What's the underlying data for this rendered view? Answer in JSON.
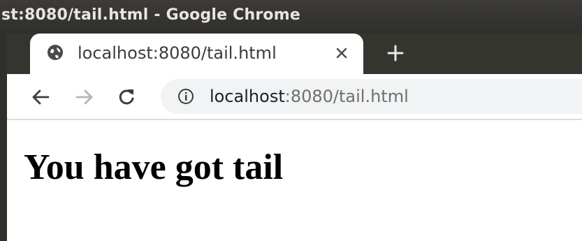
{
  "window": {
    "title": "st:8080/tail.html - Google Chrome"
  },
  "tab": {
    "title": "localhost:8080/tail.html",
    "favicon": "globe-icon",
    "close_icon": "close-icon"
  },
  "new_tab_icon": "plus-icon",
  "toolbar": {
    "back_icon": "arrow-left-icon",
    "forward_icon": "arrow-right-icon",
    "reload_icon": "reload-icon",
    "info_icon": "info-icon"
  },
  "address_bar": {
    "host": "localhost",
    "rest": ":8080/tail.html"
  },
  "page": {
    "heading": "You have got tail"
  },
  "colors": {
    "titlebar": "#3c3b37",
    "tabstrip": "#35352f",
    "omnibox": "#f1f3f4",
    "url_host": "#202124",
    "url_rest": "#6f6f6f"
  }
}
